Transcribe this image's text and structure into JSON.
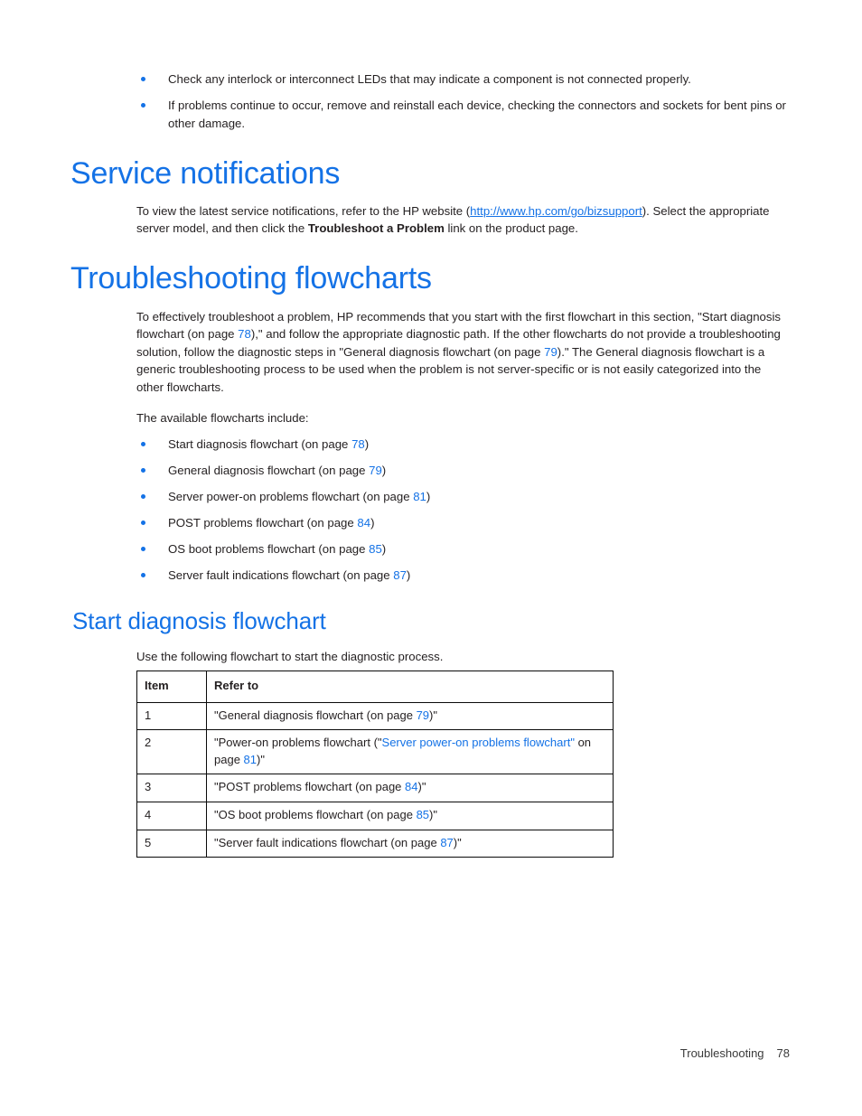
{
  "colors": {
    "heading_blue": "#1472e6",
    "link_blue": "#1472e6",
    "body_text": "#231f20",
    "table_border": "#0a0a0a"
  },
  "top_bullets": [
    "Check any interlock or interconnect LEDs that may indicate a component is not connected properly.",
    "If problems continue to occur, remove and reinstall each device, checking the connectors and sockets for bent pins or other damage."
  ],
  "service_notifications": {
    "heading": "Service notifications",
    "para_before_link": "To view the latest service notifications, refer to the HP website (",
    "link_text": "http://www.hp.com/go/bizsupport",
    "para_after_link": "). Select the appropriate server model, and then click the ",
    "bold_phrase": "Troubleshoot a Problem",
    "para_tail": " link on the product page."
  },
  "troubleshooting_flowcharts": {
    "heading": "Troubleshooting flowcharts",
    "intro_part1": "To effectively troubleshoot a problem, HP recommends that you start with the first flowchart in this section, \"Start diagnosis flowchart (on page ",
    "intro_page_1": "78",
    "intro_part2": "),\" and follow the appropriate diagnostic path. If the other flowcharts do not provide a troubleshooting solution, follow the diagnostic steps in \"General diagnosis flowchart (on page ",
    "intro_page_2": "79",
    "intro_part3": ").\" The General diagnosis flowchart is a generic troubleshooting process to be used when the problem is not server-specific or is not easily categorized into the other flowcharts.",
    "available_label": "The available flowcharts include:",
    "items": [
      {
        "text_before": "Start diagnosis flowchart (on page ",
        "page": "78",
        "text_after": ")"
      },
      {
        "text_before": "General diagnosis flowchart (on page ",
        "page": "79",
        "text_after": ")"
      },
      {
        "text_before": "Server power-on problems flowchart (on page ",
        "page": "81",
        "text_after": ")"
      },
      {
        "text_before": "POST problems flowchart (on page ",
        "page": "84",
        "text_after": ")"
      },
      {
        "text_before": "OS boot problems flowchart (on page ",
        "page": "85",
        "text_after": ")"
      },
      {
        "text_before": "Server fault indications flowchart (on page ",
        "page": "87",
        "text_after": ")"
      }
    ]
  },
  "start_diagnosis_flowchart": {
    "heading": "Start diagnosis flowchart",
    "intro": "Use the following flowchart to start the diagnostic process.",
    "table": {
      "headers": [
        "Item",
        "Refer to"
      ],
      "rows": [
        {
          "item": "1",
          "before": "\"General diagnosis flowchart (on page ",
          "page": "79",
          "after": ")\""
        },
        {
          "item": "2",
          "before": "\"Power-on problems flowchart (\"",
          "xref": "Server power-on problems flowchart\"",
          "middle": " on page ",
          "page": "81",
          "after": ")\""
        },
        {
          "item": "3",
          "before": "\"POST problems flowchart (on page ",
          "page": "84",
          "after": ")\""
        },
        {
          "item": "4",
          "before": "\"OS boot problems flowchart (on page ",
          "page": "85",
          "after": ")\""
        },
        {
          "item": "5",
          "before": "\"Server fault indications flowchart (on page ",
          "page": "87",
          "after": ")\""
        }
      ]
    }
  },
  "footer": {
    "chapter": "Troubleshooting",
    "page_number": "78"
  }
}
